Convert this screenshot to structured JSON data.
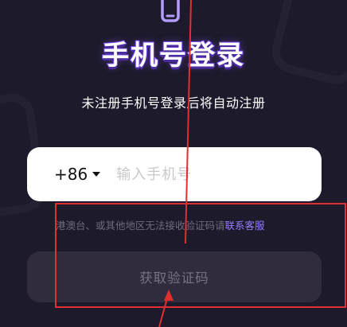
{
  "header": {
    "title": "手机号登录",
    "subtitle": "未注册手机号登录后将自动注册"
  },
  "phone_input": {
    "country_code": "+86",
    "placeholder": "输入手机号",
    "value": ""
  },
  "hint": {
    "text": "港澳台、或其他地区无法接收验证码请",
    "link_label": "联系客服"
  },
  "actions": {
    "get_code_label": "获取验证码"
  },
  "icons": {
    "top": "phone-icon",
    "country_dropdown": "caret-down-icon"
  },
  "colors": {
    "background": "#1d1a2b",
    "accent": "#9a7cff",
    "title_stroke": "#7c4dff",
    "annotation": "#e03030",
    "button_disabled_bg": "#302c3d"
  }
}
